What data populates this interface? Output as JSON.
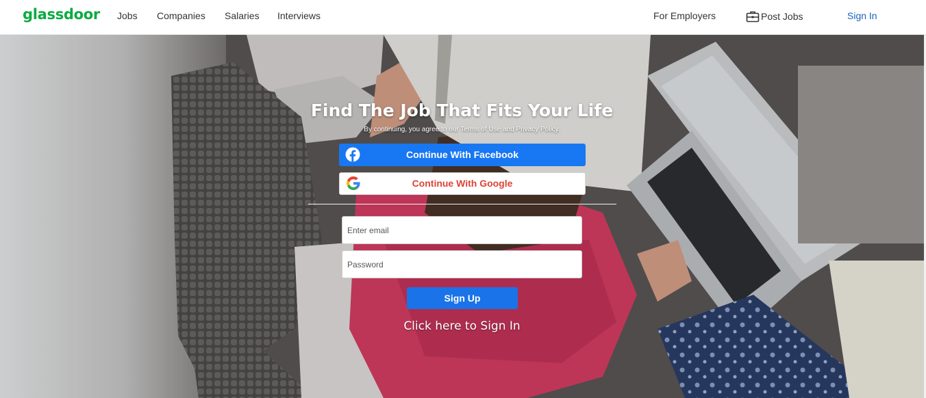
{
  "header": {
    "logo": "glassdoor",
    "nav": {
      "jobs": "Jobs",
      "companies": "Companies",
      "salaries": "Salaries",
      "interviews": "Interviews"
    },
    "for_employers": "For Employers",
    "post_jobs": "Post Jobs",
    "sign_in": "Sign In"
  },
  "signup": {
    "title": "Find The Job That Fits Your Life",
    "terms": "By continuing, you agree to our Terms of Use and Privacy Policy.",
    "facebook_label": "Continue With Facebook",
    "google_label": "Continue With Google",
    "email_placeholder": "Enter email",
    "password_placeholder": "Password",
    "submit_label": "Sign Up",
    "signin_link": "Click here to Sign In"
  },
  "icons": {
    "post_jobs": "briefcase-icon",
    "facebook": "facebook-icon",
    "google": "google-icon"
  },
  "colors": {
    "brand_green": "#0caa41",
    "facebook_blue": "#1877f2",
    "google_red": "#db4437",
    "primary_blue": "#1a73e8",
    "sign_in_blue": "#1861bf"
  }
}
